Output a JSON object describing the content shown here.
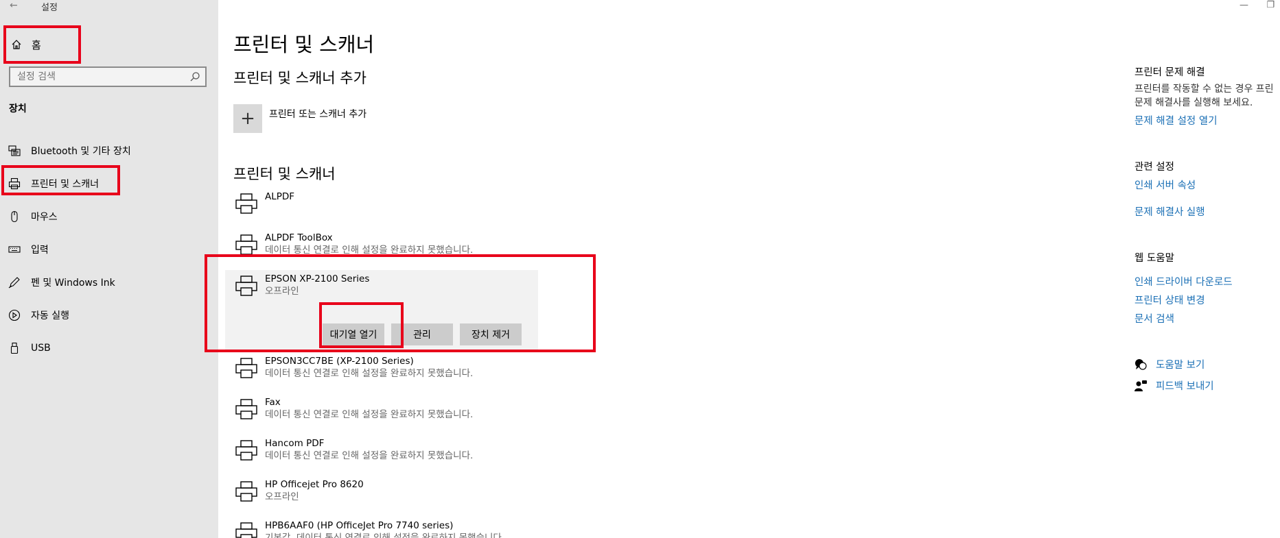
{
  "window": {
    "title": "설정"
  },
  "sidebar": {
    "home_label": "홈",
    "search_placeholder": "설정 검색",
    "section": "장치",
    "items": [
      {
        "label": "Bluetooth 및 기타 장치",
        "icon": "bluetooth-devices-icon"
      },
      {
        "label": "프린터 및 스캐너",
        "icon": "printer-icon"
      },
      {
        "label": "마우스",
        "icon": "mouse-icon"
      },
      {
        "label": "입력",
        "icon": "keyboard-icon"
      },
      {
        "label": "펜 및 Windows Ink",
        "icon": "pen-icon"
      },
      {
        "label": "자동 실행",
        "icon": "autoplay-icon"
      },
      {
        "label": "USB",
        "icon": "usb-icon"
      }
    ]
  },
  "main": {
    "title": "프린터 및 스캐너",
    "add_section": "프린터 및 스캐너 추가",
    "add_label": "프린터 또는 스캐너 추가",
    "list_section": "프린터 및 스캐너",
    "printers": [
      {
        "name": "ALPDF",
        "status": ""
      },
      {
        "name": "ALPDF ToolBox",
        "status": "데이터 통신 연결로 인해 설정을 완료하지 못했습니다."
      },
      {
        "name": "EPSON XP-2100 Series",
        "status": "오프라인"
      },
      {
        "name": "EPSON3CC7BE (XP-2100 Series)",
        "status": "데이터 통신 연결로 인해 설정을 완료하지 못했습니다."
      },
      {
        "name": "Fax",
        "status": "데이터 통신 연결로 인해 설정을 완료하지 못했습니다."
      },
      {
        "name": "Hancom PDF",
        "status": "데이터 통신 연결로 인해 설정을 완료하지 못했습니다."
      },
      {
        "name": "HP Officejet Pro 8620",
        "status": "오프라인"
      },
      {
        "name": "HPB6AAF0 (HP OfficeJet Pro 7740 series)",
        "status": "기본값, 데이터 통신 연결로 인해 설정을 완료하지 못했습니다."
      }
    ],
    "actions": {
      "open_queue": "대기열 열기",
      "manage": "관리",
      "remove": "장치 제거"
    }
  },
  "right_panel": {
    "troubleshoot_title": "프린터 문제 해결",
    "troubleshoot_line1": "프린터를 작동할 수 없는 경우 프린",
    "troubleshoot_line2": "문제 해결사를 실행해 보세요.",
    "troubleshoot_link": "문제 해결 설정 열기",
    "related_title": "관련 설정",
    "related_links": [
      "인쇄 서버 속성",
      "문제 해결사 실행"
    ],
    "web_help_title": "웹 도움말",
    "web_help_links": [
      "인쇄 드라이버 다운로드",
      "프린터 상태 변경",
      "문서 검색"
    ],
    "help_link": "도움말 보기",
    "feedback_link": "피드백 보내기"
  },
  "colors": {
    "sidebar_bg": "#e6e6e6",
    "highlight": "#e8001a",
    "link": "#1a6fb5",
    "button": "#cccccc"
  }
}
